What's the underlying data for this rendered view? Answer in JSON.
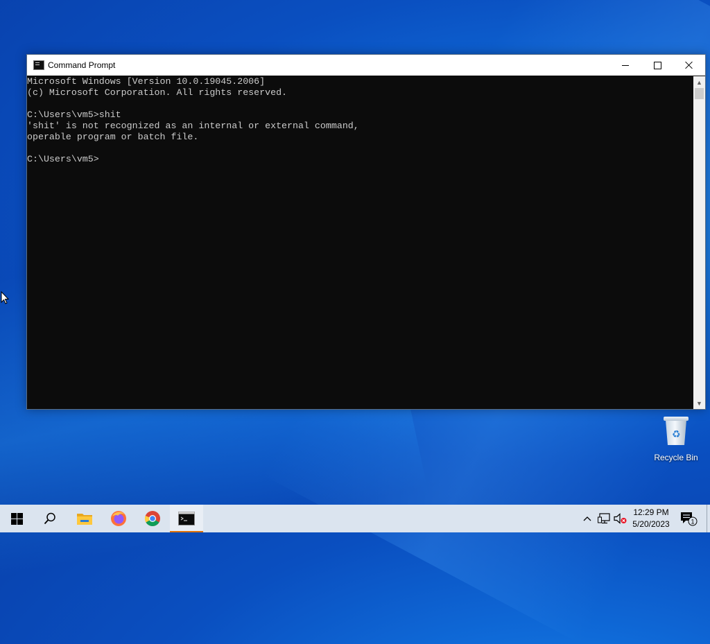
{
  "window": {
    "title": "Command Prompt",
    "minimize_icon": "minimize-icon",
    "maximize_icon": "maximize-icon",
    "close_icon": "close-icon"
  },
  "console": {
    "lines": [
      "Microsoft Windows [Version 10.0.19045.2006]",
      "(c) Microsoft Corporation. All rights reserved.",
      "",
      "C:\\Users\\vm5>shit",
      "'shit' is not recognized as an internal or external command,",
      "operable program or batch file.",
      "",
      "C:\\Users\\vm5>"
    ],
    "text_color": "#cccccc",
    "background_color": "#0c0c0c"
  },
  "desktop": {
    "recycle_bin_label": "Recycle Bin"
  },
  "taskbar": {
    "items": [
      {
        "name": "start-button",
        "icon": "windows-logo-icon"
      },
      {
        "name": "search-button",
        "icon": "search-icon"
      },
      {
        "name": "file-explorer-button",
        "icon": "folder-icon"
      },
      {
        "name": "firefox-button",
        "icon": "firefox-icon"
      },
      {
        "name": "chrome-button",
        "icon": "chrome-icon"
      },
      {
        "name": "command-prompt-button",
        "icon": "command-prompt-icon",
        "active": true
      }
    ],
    "tray_icons": [
      "chevron-up-icon",
      "network-icon",
      "volume-muted-icon"
    ],
    "time": "12:29 PM",
    "date": "5/20/2023",
    "notification_count": "1",
    "accent_color": "#e0720a"
  }
}
